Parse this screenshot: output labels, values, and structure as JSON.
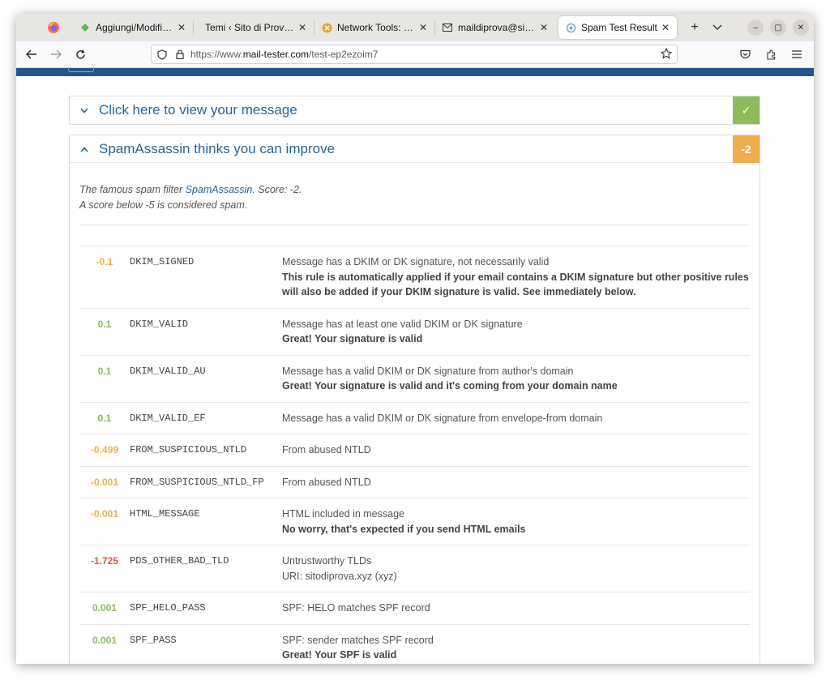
{
  "browser": {
    "tabs": [
      {
        "label": "Aggiungi/Modifica re",
        "icon": "wp-diamond-icon",
        "active": false
      },
      {
        "label": "Temi ‹ Sito di Prova — W",
        "icon": "none",
        "active": false
      },
      {
        "label": "Network Tools: DNS,",
        "icon": "network-tools-icon",
        "active": false
      },
      {
        "label": "maildiprova@sitodip",
        "icon": "mail-icon",
        "active": false
      },
      {
        "label": "Spam Test Result",
        "icon": "spam-test-icon",
        "active": true
      }
    ],
    "url_prefix": "https://www.",
    "url_host": "mail-tester.com",
    "url_path": "/test-ep2ezoim7"
  },
  "message_panel": {
    "title": "Click here to view your message",
    "badge": "✓",
    "badge_color": "#8fbc5a"
  },
  "spam_panel": {
    "title": "SpamAssassin thinks you can improve",
    "badge": "-2",
    "badge_color": "#f0ad4e",
    "intro_pre": "The famous spam filter ",
    "intro_link": "SpamAssassin",
    "intro_post": ". Score: -2.",
    "intro_line2": "A score below -5 is considered spam."
  },
  "rules": [
    {
      "score": "-0.1",
      "color": "#f0ad4e",
      "code": "DKIM_SIGNED",
      "message": "Message has a DKIM or DK signature, not necessarily valid",
      "note": "This rule is automatically applied if your email contains a DKIM signature but other positive rules will also be added if your DKIM signature is valid. See immediately below."
    },
    {
      "score": "0.1",
      "color": "#8fbc5a",
      "code": "DKIM_VALID",
      "message": "Message has at least one valid DKIM or DK signature",
      "note": "Great! Your signature is valid"
    },
    {
      "score": "0.1",
      "color": "#8fbc5a",
      "code": "DKIM_VALID_AU",
      "message": "Message has a valid DKIM or DK signature from author's domain",
      "note": "Great! Your signature is valid and it's coming from your domain name"
    },
    {
      "score": "0.1",
      "color": "#8fbc5a",
      "code": "DKIM_VALID_EF",
      "message": "Message has a valid DKIM or DK signature from envelope-from domain",
      "note": ""
    },
    {
      "score": "-0.499",
      "color": "#f0ad4e",
      "code": "FROM_SUSPICIOUS_NTLD",
      "message": "From abused NTLD",
      "note": ""
    },
    {
      "score": "-0.001",
      "color": "#f0ad4e",
      "code": "FROM_SUSPICIOUS_NTLD_FP",
      "message": "From abused NTLD",
      "note": ""
    },
    {
      "score": "-0.001",
      "color": "#f0ad4e",
      "code": "HTML_MESSAGE",
      "message": "HTML included in message",
      "note": "No worry, that's expected if you send HTML emails"
    },
    {
      "score": "-1.725",
      "color": "#d9534f",
      "code": "PDS_OTHER_BAD_TLD",
      "message": "Untrustworthy TLDs",
      "note_plain": "URI: sitodiprova.xyz (xyz)",
      "note": ""
    },
    {
      "score": "0.001",
      "color": "#8fbc5a",
      "code": "SPF_HELO_PASS",
      "message": "SPF: HELO matches SPF record",
      "note": ""
    },
    {
      "score": "0.001",
      "color": "#8fbc5a",
      "code": "SPF_PASS",
      "message": "SPF: sender matches SPF record",
      "note": "Great! Your SPF is valid"
    }
  ]
}
